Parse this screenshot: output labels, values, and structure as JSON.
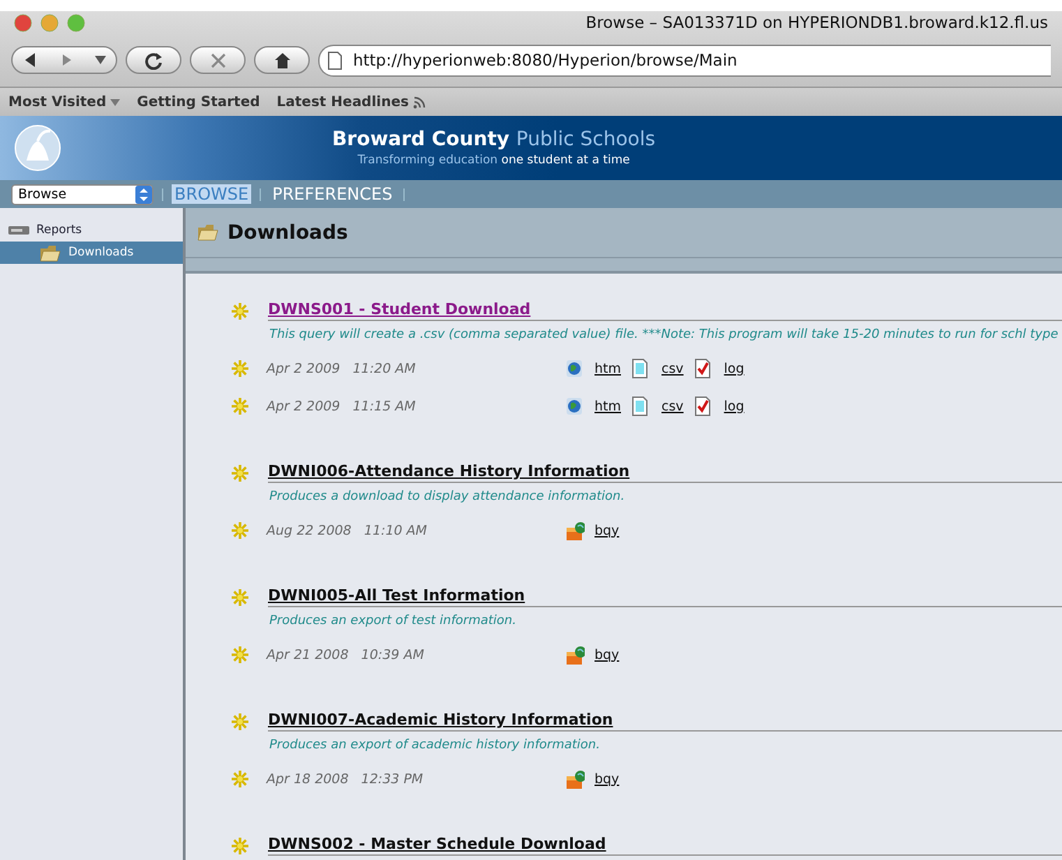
{
  "window": {
    "title": "Browse – SA013371D on HYPERIONDB1.broward.k12.fl.us"
  },
  "toolbar": {
    "url": "http://hyperionweb:8080/Hyperion/browse/Main"
  },
  "bookmarks": [
    {
      "label": "Most Visited",
      "kind": "menu"
    },
    {
      "label": "Getting Started",
      "kind": "link"
    },
    {
      "label": "Latest Headlines",
      "kind": "feed"
    }
  ],
  "banner": {
    "name_bold": "Broward County",
    "name_light": "Public Schools",
    "tagline_1": "Transforming education",
    "tagline_2": "one student at a time"
  },
  "nav": {
    "select": "Browse",
    "tabs": [
      {
        "label": "BROWSE",
        "selected": true
      },
      {
        "label": "PREFERENCES",
        "selected": false
      }
    ]
  },
  "sidebar": {
    "items": [
      {
        "label": "Reports",
        "selected": false,
        "children": [
          {
            "label": "Downloads",
            "selected": true
          }
        ]
      }
    ]
  },
  "content": {
    "title": "Downloads",
    "items": [
      {
        "title": "DWNS001 - Student Download",
        "visited": true,
        "description": "This query will create a .csv (comma separated value) file. ***Note: This program will take 15-20 minutes to run for schl type",
        "runs": [
          {
            "date": "Apr 2 2009",
            "time": "11:20 AM",
            "files": [
              {
                "kind": "htm",
                "label": "htm"
              },
              {
                "kind": "csv",
                "label": "csv"
              },
              {
                "kind": "log",
                "label": "log"
              }
            ]
          },
          {
            "date": "Apr 2 2009",
            "time": "11:15 AM",
            "files": [
              {
                "kind": "htm",
                "label": "htm"
              },
              {
                "kind": "csv",
                "label": "csv"
              },
              {
                "kind": "log",
                "label": "log"
              }
            ]
          }
        ]
      },
      {
        "title": "DWNI006-Attendance History Information",
        "visited": false,
        "description": "Produces a download to display attendance information.",
        "runs": [
          {
            "date": "Aug 22 2008",
            "time": "11:10 AM",
            "files": [
              {
                "kind": "bqy",
                "label": "bqy"
              }
            ]
          }
        ]
      },
      {
        "title": "DWNI005-All Test Information",
        "visited": false,
        "description": "Produces an export of test information.",
        "runs": [
          {
            "date": "Apr 21 2008",
            "time": "10:39 AM",
            "files": [
              {
                "kind": "bqy",
                "label": "bqy"
              }
            ]
          }
        ]
      },
      {
        "title": "DWNI007-Academic History Information",
        "visited": false,
        "description": "Produces an export of academic history information.",
        "runs": [
          {
            "date": "Apr 18 2008",
            "time": "12:33 PM",
            "files": [
              {
                "kind": "bqy",
                "label": "bqy"
              }
            ]
          }
        ]
      },
      {
        "title": "DWNS002 - Master Schedule Download",
        "visited": false
      }
    ]
  }
}
